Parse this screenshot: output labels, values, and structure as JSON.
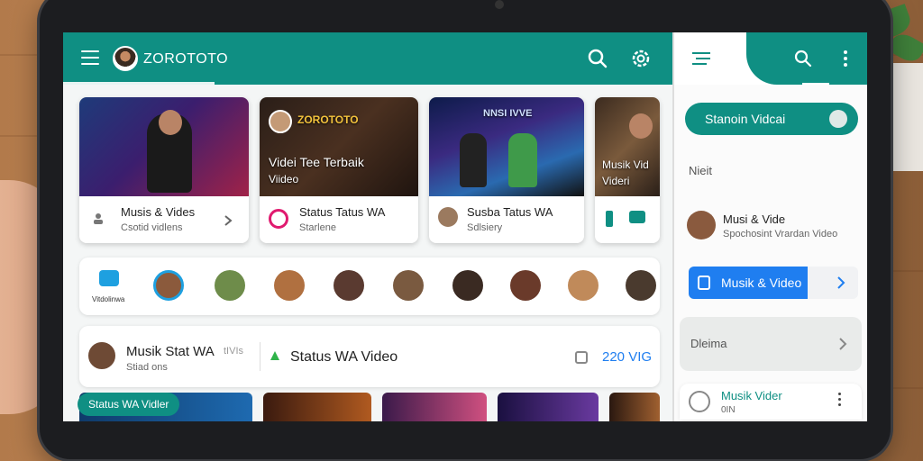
{
  "app": {
    "title": "ZOROTOTO"
  },
  "header_icons": [
    "menu-icon",
    "search-icon",
    "settings-icon"
  ],
  "cards": [
    {
      "title": "Musis & Vides",
      "subtitle": "Csotid vidlens",
      "overlay1": "",
      "overlay2": ""
    },
    {
      "title": "Status Tatus WA",
      "subtitle": "Starlene",
      "overlay1": "ZOROTOTO",
      "overlay2": "Videi Tee Terbaik",
      "overlay3": "Viideo"
    },
    {
      "title": "Susba Tatus WA",
      "subtitle": "Sdlsiery",
      "overlay1": "NNSI IVVE",
      "overlay2": "",
      "overlay3": ""
    },
    {
      "title": "",
      "subtitle": "",
      "overlay1": "",
      "overlay2": "Musik Vid",
      "overlay3": "Videri"
    }
  ],
  "stories": {
    "first_label": "Vitdolinwa"
  },
  "row": {
    "title": "Musik Stat WA",
    "title_extra": "tIVIs",
    "subtitle": "Stiad ons",
    "center": "Status WA Video",
    "right": "220 VIG"
  },
  "bottom_pill": "Status WA Vidler",
  "right_panel": {
    "pill": "Stanoin Vidcai",
    "label1": "Nieit",
    "item_title": "Musi & Vide",
    "item_sub": "Spochosint Vrardan Video",
    "blue_label": "Musik & Video",
    "grey_label": "Dleima",
    "last_title": "Musik Vider",
    "last_sub": "0IN"
  },
  "colors": {
    "teal": "#0f8f83",
    "blue": "#1f7ef0"
  }
}
